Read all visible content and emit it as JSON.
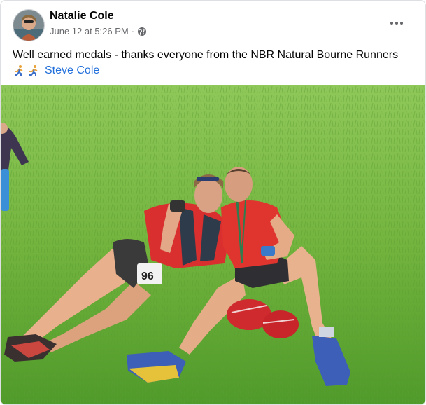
{
  "post": {
    "author_name": "Natalie Cole",
    "timestamp": "June 12 at 5:26 PM",
    "separator": "·",
    "privacy_icon": "globe-icon",
    "more_icon": "more-options-icon",
    "text": "Well earned medals - thanks everyone from the NBR Natural Bourne Runners",
    "emoji_icons": [
      "running-man-icon",
      "running-man-icon"
    ],
    "tagged_user": "Steve Cole",
    "link_color": "#216fdb"
  }
}
